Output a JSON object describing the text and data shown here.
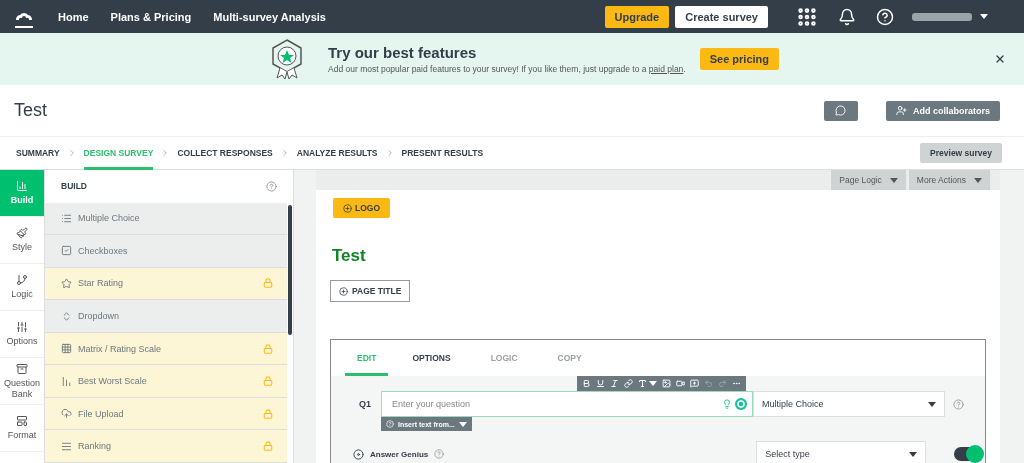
{
  "nav": {
    "links": [
      "Home",
      "Plans & Pricing",
      "Multi-survey Analysis"
    ],
    "upgrade": "Upgrade",
    "create": "Create survey"
  },
  "banner": {
    "title": "Try our best features",
    "text": "Add our most popular paid features to your survey! If you like them, just upgrade to a",
    "link": "paid plan",
    "text_end": ".",
    "button": "See pricing"
  },
  "survey_title": "Test",
  "collaborators": "Add collaborators",
  "steps": [
    {
      "label": "SUMMARY",
      "selected": false
    },
    {
      "label": "DESIGN SURVEY",
      "selected": true
    },
    {
      "label": "COLLECT RESPONSES",
      "selected": false
    },
    {
      "label": "ANALYZE RESULTS",
      "selected": false
    },
    {
      "label": "PRESENT RESULTS",
      "selected": false
    }
  ],
  "preview": "Preview survey",
  "rail": [
    {
      "label": "Build",
      "selected": true
    },
    {
      "label": "Style",
      "selected": false
    },
    {
      "label": "Logic",
      "selected": false
    },
    {
      "label": "Options",
      "selected": false
    },
    {
      "label": "Question Bank",
      "selected": false
    },
    {
      "label": "Format",
      "selected": false
    }
  ],
  "build": {
    "title": "BUILD",
    "items": [
      {
        "label": "Multiple Choice",
        "locked": false
      },
      {
        "label": "Checkboxes",
        "locked": false
      },
      {
        "label": "Star Rating",
        "locked": true
      },
      {
        "label": "Dropdown",
        "locked": false
      },
      {
        "label": "Matrix / Rating Scale",
        "locked": true
      },
      {
        "label": "Best Worst Scale",
        "locked": true
      },
      {
        "label": "File Upload",
        "locked": true
      },
      {
        "label": "Ranking",
        "locked": true
      }
    ]
  },
  "canvas": {
    "actions": [
      "Page Logic",
      "More Actions"
    ],
    "logo": "LOGO",
    "heading": "Test",
    "page_title": "PAGE TITLE",
    "question": {
      "tabs": [
        {
          "label": "EDIT",
          "selected": true,
          "disabled": false
        },
        {
          "label": "OPTIONS",
          "selected": false,
          "disabled": false
        },
        {
          "label": "LOGIC",
          "selected": false,
          "disabled": true
        },
        {
          "label": "COPY",
          "selected": false,
          "disabled": true
        }
      ],
      "number": "Q1",
      "placeholder": "Enter your question",
      "type": "Multiple Choice",
      "insert": "Insert text from...",
      "answer_genius": {
        "label": "Answer Genius",
        "select": "Select type",
        "on": true
      }
    }
  }
}
